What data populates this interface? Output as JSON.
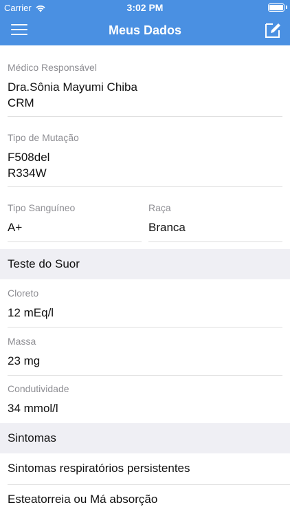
{
  "status_bar": {
    "carrier": "Carrier",
    "time": "3:02 PM",
    "battery_level": 1.0
  },
  "nav": {
    "title": "Meus Dados",
    "menu_icon": "hamburger-menu-icon",
    "edit_icon": "edit-pencil-icon"
  },
  "fields": {
    "medico": {
      "label": "Médico Responsável",
      "line1": "Dra.Sônia Mayumi Chiba",
      "line2": "CRM"
    },
    "mutacao": {
      "label": "Tipo de Mutação",
      "line1": "F508del",
      "line2": "R334W"
    },
    "sanguineo": {
      "label": "Tipo Sanguíneo",
      "value": "A+"
    },
    "raca": {
      "label": "Raça",
      "value": "Branca"
    }
  },
  "sections": {
    "teste_suor": {
      "title": "Teste do Suor"
    },
    "sintomas": {
      "title": "Sintomas"
    }
  },
  "suor": {
    "cloreto": {
      "label": "Cloreto",
      "value": "12 mEq/l"
    },
    "massa": {
      "label": "Massa",
      "value": "23 mg"
    },
    "condutividade": {
      "label": "Condutividade",
      "value": "34 mmol/l"
    }
  },
  "sintomas_list": [
    "Sintomas respiratórios persistentes",
    "Esteatorreia ou Má absorção"
  ],
  "colors": {
    "primary": "#4a90e2",
    "section_bg": "#efeff4",
    "label": "#8e8e93",
    "divider": "#dedede"
  }
}
